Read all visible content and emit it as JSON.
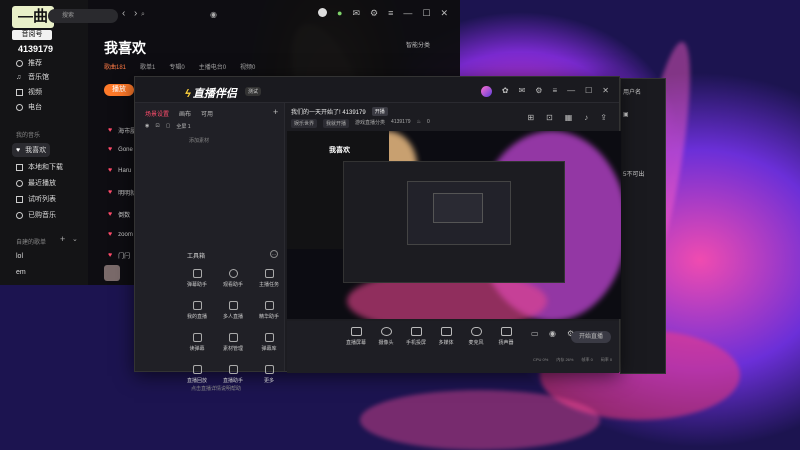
{
  "music_app": {
    "logo_mark": "—曲",
    "logo_tag": "音阅号",
    "user_id": "4139179",
    "sidebar": {
      "top_items": [
        "推荐",
        "音乐馆",
        "视频",
        "电台"
      ],
      "section_my": "我的音乐",
      "my_items": [
        "我喜欢",
        "本地和下载",
        "最近播放",
        "试听列表",
        "已购音乐"
      ],
      "section_created": "自建的歌单",
      "playlists": [
        "lol",
        "em"
      ]
    },
    "search_placeholder": "搜索",
    "page_title": "我喜欢",
    "manage_label": "智能分类",
    "tabs": [
      "歌曲181",
      "歌单1",
      "专辑0",
      "主播电台0",
      "视频0"
    ],
    "play_all": "播放",
    "songs": [
      "海市蜃",
      "Gone",
      "Haru",
      "明明就",
      "倒数",
      "zoom",
      "门闩"
    ]
  },
  "live_app": {
    "name": "直播伴侣",
    "version_badge": "测试",
    "left_tabs": [
      "场景设置",
      "画布",
      "可用",
      "添加"
    ],
    "scene_label": "全屏 1",
    "scene_sub": "添加素材",
    "toolbox_title": "工具箱",
    "tools": [
      "弹幕助手",
      "观看助手",
      "主播任务",
      "我的直播",
      "多人直播",
      "精华助手",
      "读弹幕",
      "素材管理",
      "弹幕库",
      "直播回放",
      "直播助手",
      "更多"
    ],
    "bottom_tip": "点击直播详情说明帮助",
    "stream_title": "我们的一天开始了! 4139179",
    "stream_title_tag": "开播",
    "meta_pills": [
      "娱乐世界",
      "我就开播"
    ],
    "meta_extra": "游戏直播分类",
    "meta_id": "4139179",
    "meta_count": "0",
    "controls": [
      "直播屏幕",
      "摄像头",
      "手机投屏",
      "多媒体",
      "麦克风",
      "扬声器"
    ],
    "start_button": "开始直播",
    "status_items": [
      "CPU 0%",
      "内存 26%",
      "帧率 0",
      "码率 0"
    ]
  },
  "preview": {
    "mini_title": "我喜欢"
  },
  "fragment": {
    "lines": [
      "用户名",
      "5不可出"
    ]
  }
}
